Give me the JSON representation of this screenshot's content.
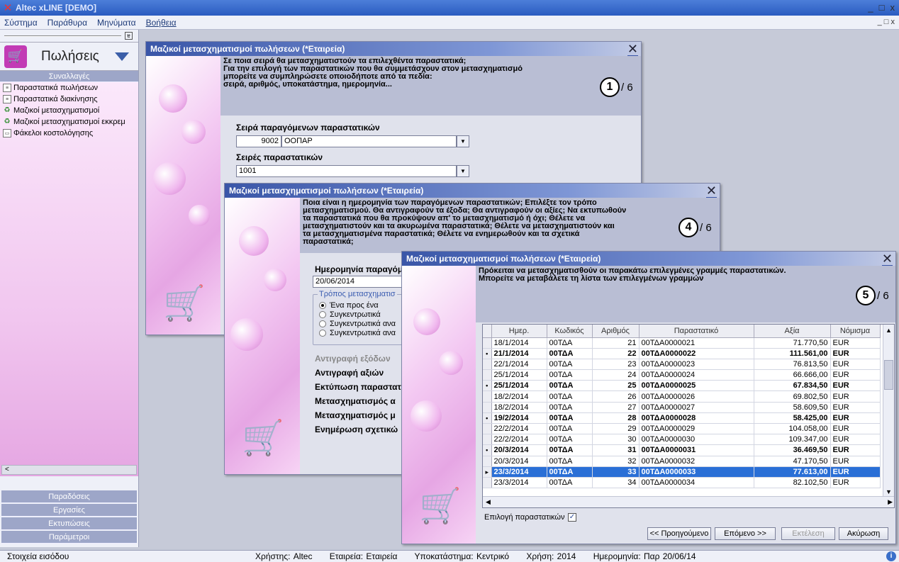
{
  "app": {
    "title": "Altec xLINE [DEMO]",
    "icon": "x-logo-icon"
  },
  "window_controls": [
    "_",
    "□",
    "x"
  ],
  "menu": [
    {
      "label": "Σύστημα"
    },
    {
      "label": "Παράθυρα"
    },
    {
      "label": "Μηνύματα"
    },
    {
      "label": "Βοήθεια"
    }
  ],
  "menu_right": "_ □ x",
  "sidebar": {
    "pin": "ɐ",
    "title": "Πωλήσεις",
    "section_top": "Συναλλαγές",
    "items": [
      {
        "label": "Παραστατικά πωλήσεων",
        "icon": "document-icon"
      },
      {
        "label": "Παραστατικά διακίνησης",
        "icon": "document-icon"
      },
      {
        "label": "Μαζικοί μετασχηματισμοί",
        "icon": "transform-icon"
      },
      {
        "label": "Μαζικοί μετασχηματισμοί εκκρεμ",
        "icon": "transform-icon"
      },
      {
        "label": "Φάκελοι κοστολόγησης",
        "icon": "folder-icon"
      }
    ],
    "bottom_sections": [
      "Παραδόσεις",
      "Εργασίες",
      "Εκτυπώσεις",
      "Παράμετροι"
    ]
  },
  "dialog1": {
    "title": "Μαζικοί μετασχηματισμοί πωλήσεων (*Εταιρεία)",
    "header_lines": [
      "Σε ποια σειρά θα μετασχηματιστούν τα επιλεχθέντα παραστατικά;",
      "Για την επιλογή των παραστατικών που θα συμμετάσχουν στον μετασχηματισμό",
      "μπορείτε να συμπληρώσετε οποιοδήποτε από τα πεδία:",
      "σειρά, αριθμός, υποκατάστημα, ημερομηνία..."
    ],
    "step": "1",
    "step_total": "/ 6",
    "series_label": "Σειρά παραγόμενων παραστατικών",
    "series_code": "9002",
    "series_name": "ΟΟΠΑΡ",
    "series_list_label": "Σειρές παραστατικών",
    "series_list_value": "1001"
  },
  "dialog2": {
    "title": "Μαζικοί μετασχηματισμοί πωλήσεων (*Εταιρεία)",
    "header_lines": [
      "Ποια είναι η ημερομηνία των παραγόμενων παραστατικών; Επιλέξτε τον τρόπο",
      "μετασχηματισμού. Θα αντιγραφούν τα έξοδα; Θα αντιγραφούν οι αξίες; Να εκτυπωθούν",
      "τα παραστατικά που θα προκύψουν απ' το μετασχηματισμό ή όχι; Θέλετε να",
      "μετασχηματιστούν και τα ακυρωμένα παραστατικά; Θέλετε να μετασχηματιστούν και",
      "τα μετασχηματισμένα παραστατικά; Θέλετε να ενημερωθούν και τα σχετικά",
      "παραστατικά;"
    ],
    "step": "4",
    "step_total": "/ 6",
    "date_label": "Ημερομηνία παραγόμ",
    "date_value": "20/06/2014",
    "mode_group": "Τρόπος μετασχηματισ",
    "modes": [
      {
        "label": "Ένα προς ένα",
        "checked": true
      },
      {
        "label": "Συγκεντρωτικά",
        "checked": false
      },
      {
        "label": "Συγκεντρωτικά ανα",
        "checked": false
      },
      {
        "label": "Συγκεντρωτικά ανα",
        "checked": false
      }
    ],
    "options": [
      {
        "label": "Αντιγραφή εξόδων",
        "disabled": true
      },
      {
        "label": "Αντιγραφή αξιών",
        "disabled": false
      },
      {
        "label": "Εκτύπωση παραστατ",
        "disabled": false
      },
      {
        "label": "Μετασχηματισμός α",
        "disabled": false
      },
      {
        "label": "Μετασχηματισμός μ",
        "disabled": false
      },
      {
        "label": "Ενημέρωση σχετικώ",
        "disabled": false
      }
    ]
  },
  "dialog3": {
    "title": "Μαζικοί μετασχηματισμοί πωλήσεων (*Εταιρεία)",
    "header_lines": [
      "Πρόκειται να μετασχηματισθούν οι παρακάτω επιλεγμένες γραμμές παραστατικών.",
      "Μπορείτε να μεταβάλετε τη λίστα των επιλεγμένων γραμμών"
    ],
    "step": "5",
    "step_total": "/ 6",
    "columns": [
      "Ημερ.",
      "Κωδικός",
      "Αριθμός",
      "Παραστατικό",
      "Αξία",
      "Νόμισμα"
    ],
    "rows": [
      {
        "marker": "",
        "date": "18/1/2014",
        "code": "00ΤΔΑ",
        "num": "21",
        "doc": "00ΤΔΑ0000021",
        "value": "71.770,50",
        "cur": "EUR",
        "bold": false
      },
      {
        "marker": "•",
        "date": "21/1/2014",
        "code": "00ΤΔΑ",
        "num": "22",
        "doc": "00ΤΔΑ0000022",
        "value": "111.561,00",
        "cur": "EUR",
        "bold": true
      },
      {
        "marker": "",
        "date": "22/1/2014",
        "code": "00ΤΔΑ",
        "num": "23",
        "doc": "00ΤΔΑ0000023",
        "value": "76.813,50",
        "cur": "EUR",
        "bold": false
      },
      {
        "marker": "",
        "date": "25/1/2014",
        "code": "00ΤΔΑ",
        "num": "24",
        "doc": "00ΤΔΑ0000024",
        "value": "66.666,00",
        "cur": "EUR",
        "bold": false
      },
      {
        "marker": "•",
        "date": "25/1/2014",
        "code": "00ΤΔΑ",
        "num": "25",
        "doc": "00ΤΔΑ0000025",
        "value": "67.834,50",
        "cur": "EUR",
        "bold": true
      },
      {
        "marker": "",
        "date": "18/2/2014",
        "code": "00ΤΔΑ",
        "num": "26",
        "doc": "00ΤΔΑ0000026",
        "value": "69.802,50",
        "cur": "EUR",
        "bold": false
      },
      {
        "marker": "",
        "date": "18/2/2014",
        "code": "00ΤΔΑ",
        "num": "27",
        "doc": "00ΤΔΑ0000027",
        "value": "58.609,50",
        "cur": "EUR",
        "bold": false
      },
      {
        "marker": "•",
        "date": "19/2/2014",
        "code": "00ΤΔΑ",
        "num": "28",
        "doc": "00ΤΔΑ0000028",
        "value": "58.425,00",
        "cur": "EUR",
        "bold": true
      },
      {
        "marker": "",
        "date": "22/2/2014",
        "code": "00ΤΔΑ",
        "num": "29",
        "doc": "00ΤΔΑ0000029",
        "value": "104.058,00",
        "cur": "EUR",
        "bold": false
      },
      {
        "marker": "",
        "date": "22/2/2014",
        "code": "00ΤΔΑ",
        "num": "30",
        "doc": "00ΤΔΑ0000030",
        "value": "109.347,00",
        "cur": "EUR",
        "bold": false
      },
      {
        "marker": "•",
        "date": "20/3/2014",
        "code": "00ΤΔΑ",
        "num": "31",
        "doc": "00ΤΔΑ0000031",
        "value": "36.469,50",
        "cur": "EUR",
        "bold": true
      },
      {
        "marker": "",
        "date": "20/3/2014",
        "code": "00ΤΔΑ",
        "num": "32",
        "doc": "00ΤΔΑ0000032",
        "value": "47.170,50",
        "cur": "EUR",
        "bold": false
      },
      {
        "marker": "▸",
        "date": "23/3/2014",
        "code": "00ΤΔΑ",
        "num": "33",
        "doc": "00ΤΔΑ0000033",
        "value": "77.613,00",
        "cur": "EUR",
        "bold": true,
        "current": true
      },
      {
        "marker": "",
        "date": "23/3/2014",
        "code": "00ΤΔΑ",
        "num": "34",
        "doc": "00ΤΔΑ0000034",
        "value": "82.102,50",
        "cur": "EUR",
        "bold": false
      }
    ],
    "select_label": "Επιλογή παραστατικών",
    "select_checked": "✓",
    "buttons": {
      "prev": "<< Προηγούμενο",
      "next": "Επόμενο >>",
      "run": "Εκτέλεση",
      "cancel": "Ακύρωση"
    }
  },
  "status": {
    "left": "Στοιχεία εισόδου",
    "user": "Χρήστης: Altec",
    "company": "Εταιρεία: Εταιρεία",
    "branch": "Υποκατάστημα: Κεντρικό",
    "year": "Χρήση: 2014",
    "date": "Ημερομηνία: Παρ 20/06/14",
    "info_icon": "i"
  }
}
